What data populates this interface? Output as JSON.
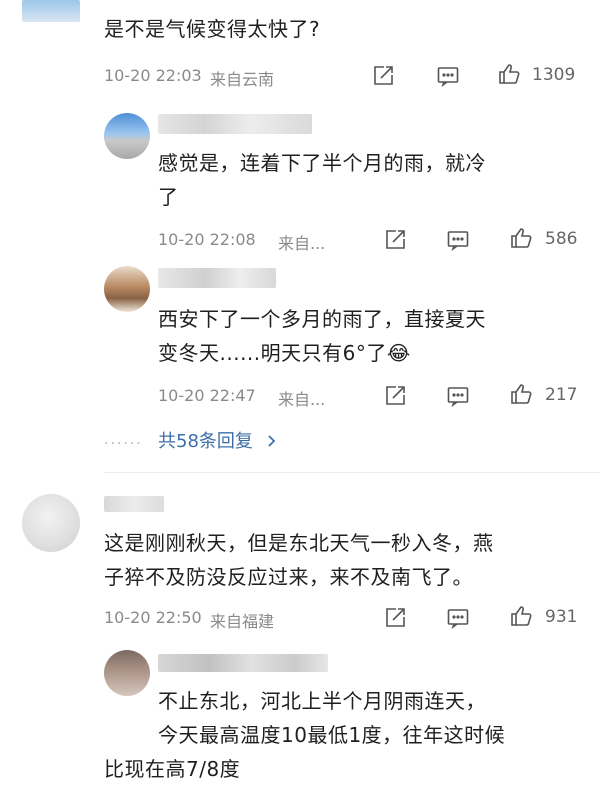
{
  "comments": [
    {
      "text": "是不是气候变得太快了?",
      "time": "10-20 22:03",
      "location": "来自云南",
      "likes": "1309",
      "replies": [
        {
          "text_line1": "感觉是，连着下了半个月的雨，就冷",
          "text_line2": "了",
          "time": "10-20 22:08",
          "location": "来自...",
          "likes": "586"
        },
        {
          "text_line1": "西安下了一个多月的雨了，直接夏天",
          "text_line2": "变冬天......明天只有6°了",
          "emoji": "😂",
          "time": "10-20 22:47",
          "location": "来自...",
          "likes": "217"
        }
      ],
      "more_replies": "共58条回复",
      "more_dots": "......"
    },
    {
      "text_line1": "这是刚刚秋天，但是东北天气一秒入冬，燕",
      "text_line2": "子猝不及防没反应过来，来不及南飞了。",
      "time": "10-20 22:50",
      "location": "来自福建",
      "likes": "931",
      "replies": [
        {
          "text_line1": "不止东北，河北上半个月阴雨连天，",
          "text_line2": "今天最高温度10最低1度，往年这时候",
          "text_line3": "比现在高7/8度"
        }
      ]
    }
  ],
  "icons": {
    "share": "share-icon",
    "comment": "comment-icon",
    "like": "thumbs-up-icon",
    "chevron": "chevron-right-icon"
  },
  "colors": {
    "link": "#3d6fa8",
    "meta": "#8a8a8a"
  }
}
